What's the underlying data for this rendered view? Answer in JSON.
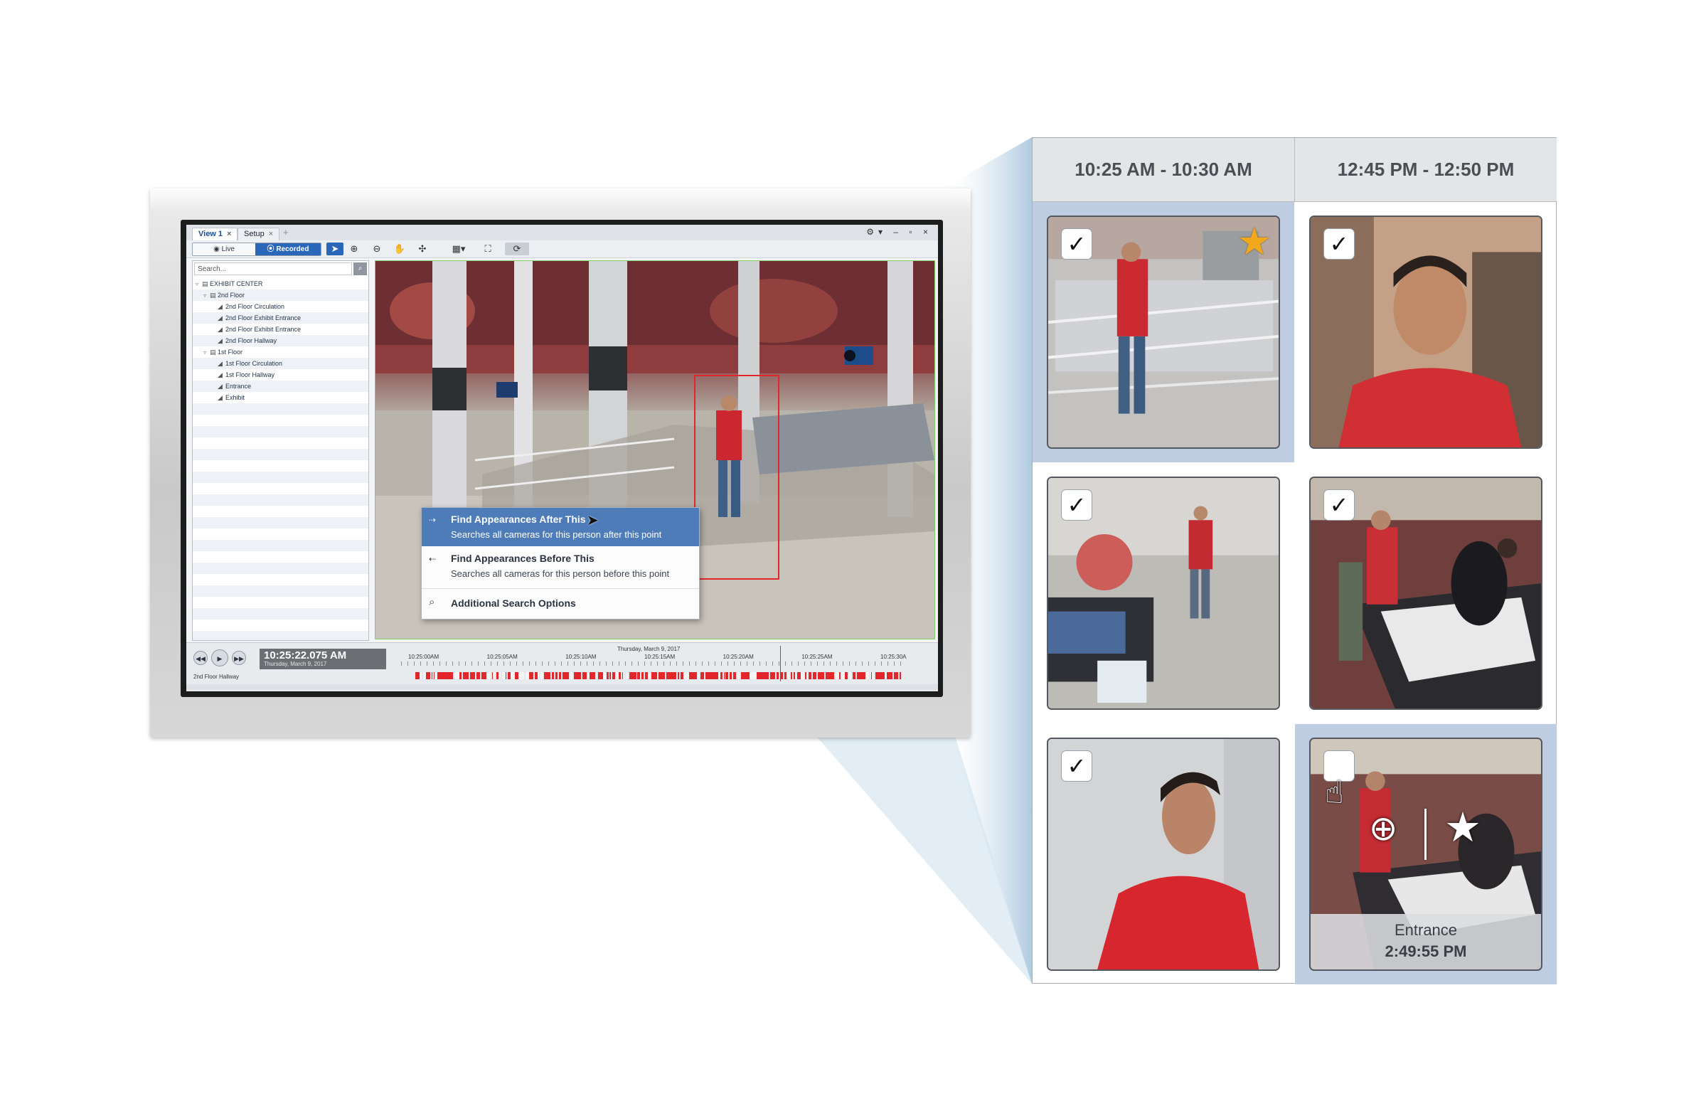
{
  "app": {
    "tabs": [
      {
        "label": "View 1",
        "close": "×"
      },
      {
        "label": "Setup",
        "close": "×"
      }
    ],
    "add_tab": "+",
    "window_controls": "⚙▾ – ▫ ×",
    "toolbar": {
      "live_label": "◉ Live",
      "recorded_label": "⦿ Recorded",
      "tools": [
        {
          "icon": "pointer-icon",
          "glyph": "➤"
        },
        {
          "icon": "zoom-in-icon",
          "glyph": "⊕"
        },
        {
          "icon": "zoom-out-icon",
          "glyph": "⊖"
        },
        {
          "icon": "pan-hand-icon",
          "glyph": "✋"
        },
        {
          "icon": "ptz-icon",
          "glyph": "✣"
        },
        {
          "icon": "layout-icon",
          "glyph": "▦▾"
        },
        {
          "icon": "fullscreen-icon",
          "glyph": "⛶"
        },
        {
          "icon": "sync-icon",
          "glyph": "⟳"
        }
      ]
    },
    "sidebar": {
      "search_placeholder": "Search...",
      "search_button_icon": "⌕",
      "tree": [
        {
          "level": 0,
          "caret": "▿",
          "icon": "▤",
          "label": "EXHIBIT CENTER"
        },
        {
          "level": 1,
          "caret": "▿",
          "icon": "▤",
          "label": "2nd Floor"
        },
        {
          "level": 2,
          "caret": "",
          "icon": "◢",
          "label": "2nd Floor Circulation"
        },
        {
          "level": 2,
          "caret": "",
          "icon": "◢",
          "label": "2nd Floor Exhibit Entrance"
        },
        {
          "level": 2,
          "caret": "",
          "icon": "◢",
          "label": "2nd Floor Exhibit Entrance"
        },
        {
          "level": 2,
          "caret": "",
          "icon": "◢",
          "label": "2nd Floor Hallway"
        },
        {
          "level": 1,
          "caret": "▿",
          "icon": "▤",
          "label": "1st Floor"
        },
        {
          "level": 2,
          "caret": "",
          "icon": "◢",
          "label": "1st Floor Circulation"
        },
        {
          "level": 2,
          "caret": "",
          "icon": "◢",
          "label": "1st Floor Hallway"
        },
        {
          "level": 2,
          "caret": "",
          "icon": "◢",
          "label": "Entrance"
        },
        {
          "level": 2,
          "caret": "",
          "icon": "◢",
          "label": "Exhibit"
        }
      ]
    },
    "context_menu": {
      "items": [
        {
          "icon": "⇢",
          "title": "Find Appearances After This",
          "subtitle": "Searches all cameras for this person after this point",
          "highlighted": true
        },
        {
          "icon": "⇠",
          "title": "Find Appearances Before This",
          "subtitle": "Searches all cameras for this person before this point",
          "highlighted": false
        }
      ],
      "additional": {
        "icon": "⌕",
        "title": "Additional Search Options"
      }
    },
    "playback": {
      "prev_icon": "◀◀",
      "play_icon": "▶",
      "next_icon": "▶▶",
      "time": "10:25:22.075 AM",
      "date": "Thursday, March 9, 2017",
      "camera": "2nd Floor Hallway",
      "timeline_date": "Thursday, March 9, 2017",
      "ticks": [
        "10:25:00AM",
        "10:25:05AM",
        "10:25:10AM",
        "10:25:15AM",
        "10:25:20AM",
        "10:25:25AM",
        "10:25:30A"
      ]
    }
  },
  "results": {
    "columns": [
      "10:25 AM - 10:30 AM",
      "12:45 PM - 12:50 PM"
    ],
    "check_glyph": "✓",
    "star_glyph": "★",
    "outline_star_glyph": "☆",
    "zoom_glyph": "⊕",
    "hand_glyph": "☝",
    "thumbnails": [
      {
        "checked": true,
        "starred": true
      },
      {
        "checked": true,
        "starred": false
      },
      {
        "checked": true,
        "starred": false
      },
      {
        "checked": true,
        "starred": false
      },
      {
        "checked": true,
        "starred": false
      },
      {
        "checked": false,
        "starred": false,
        "hovered": true
      }
    ],
    "hover_info": {
      "camera": "Entrance",
      "time": "2:49:55 PM"
    }
  },
  "colors": {
    "accent_blue": "#2a67b8",
    "menu_highlight": "#4e7cb8",
    "tracking_red": "#e3262c",
    "selection_blue": "#bfcde3",
    "star_gold": "#f2a81d"
  }
}
